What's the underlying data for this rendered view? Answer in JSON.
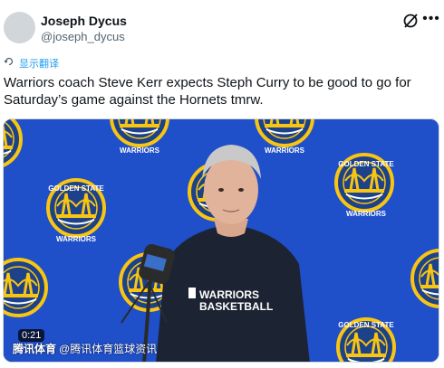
{
  "tweet": {
    "display_name": "Joseph Dycus",
    "handle": "@joseph_dycus",
    "translate_label": "显示翻译",
    "text": "Warriors coach Steve Kerr expects Steph Curry to be good to go for Saturday’s game against the Hornets tmrw."
  },
  "media": {
    "timestamp": "0:21",
    "watermark_brand": "腾讯体育",
    "watermark_handle": "@腾讯体育篮球资讯",
    "backdrop_logo_top": "GOLDEN STATE",
    "backdrop_logo_bottom": "WARRIORS",
    "shirt_line1": "WARRIORS",
    "shirt_line2": "BASKETBALL",
    "icons": [
      "grok-icon",
      "more-icon",
      "translate-icon",
      "microphone-icon",
      "play-icon"
    ]
  },
  "colors": {
    "backdrop_blue": "#1f4fc9",
    "logo_gold": "#f9c513",
    "link_blue": "#1d9bf0",
    "shirt_navy": "#1c2433"
  }
}
